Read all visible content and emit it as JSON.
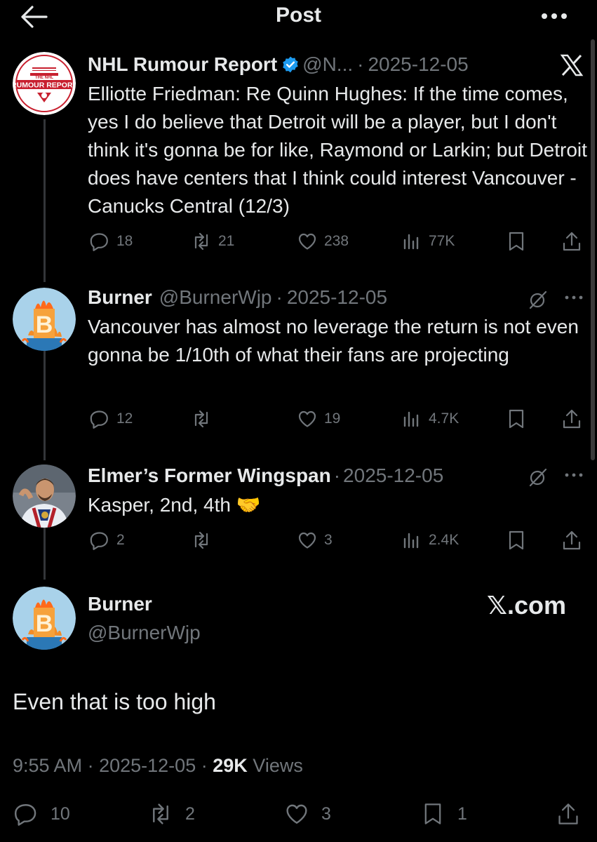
{
  "header": {
    "title": "Post"
  },
  "tweets": [
    {
      "name": "NHL Rumour Report",
      "handle": "@N...",
      "sep": "·",
      "date": "2025-12-05",
      "avatar_text": {
        "top": "THE NHL",
        "main": "RUMOUR REPORT"
      },
      "text": "Elliotte Friedman: Re Quinn Hughes: If the time comes, yes I do believe that Detroit will be a player, but I don't think it's gonna be for like, Raymond or Larkin; but Detroit does have centers that I think could interest Vancouver - Canucks Central (12/3)",
      "replies": "18",
      "reposts": "21",
      "likes": "238",
      "views": "77K"
    },
    {
      "name": "Burner",
      "handle": "@BurnerWjp",
      "sep": "·",
      "date": "2025-12-05",
      "avatar_letter": "B",
      "text": "Vancouver has almost no leverage the return is not even gonna be 1/10th of what their fans are projecting",
      "replies": "12",
      "reposts": "",
      "likes": "19",
      "views": "4.7K"
    },
    {
      "name": "Elmer’s Former Wingspan",
      "sep": "·",
      "date": "2025-12-05",
      "text": "Kasper, 2nd, 4th",
      "emoji": "🤝",
      "replies": "2",
      "reposts": "",
      "likes": "3",
      "views": "2.4K"
    }
  ],
  "main": {
    "name": "Burner",
    "handle": "@BurnerWjp",
    "avatar_letter": "B",
    "brand": "𝕏.com",
    "text": "Even that is too high",
    "time": "9:55 AM",
    "sep": "·",
    "date": "2025-12-05",
    "views_count": "29K",
    "views_label": "Views",
    "replies": "10",
    "reposts": "2",
    "likes": "3",
    "bookmarks": "1"
  },
  "colors": {
    "background": "#000000",
    "text": "#e7e9ea",
    "muted": "#71767b",
    "verified": "#1d9bf0",
    "thread_line": "#333639",
    "rumour_red": "#c8202f"
  }
}
